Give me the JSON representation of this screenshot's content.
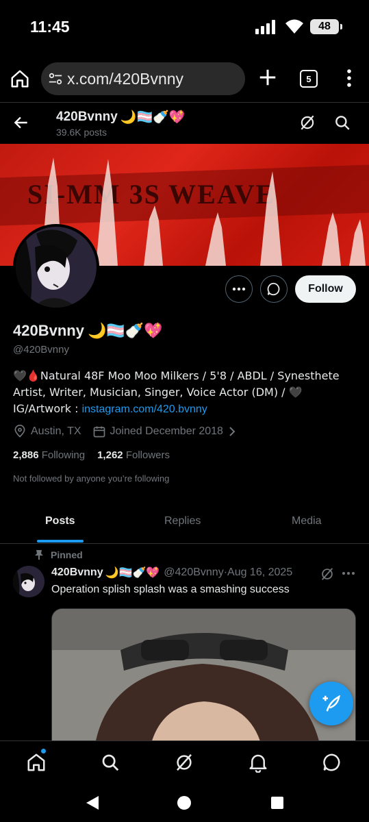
{
  "status_bar": {
    "time": "11:45",
    "battery": "48"
  },
  "browser": {
    "url": "x.com/420Bvnny",
    "tab_count": "5"
  },
  "header": {
    "name": "420Bvnny",
    "name_emojis": "🌙🏳️‍⚧️🍼💖",
    "posts_count": "39.6K posts"
  },
  "banner": {
    "text": "SI-MM 3S WEAVE"
  },
  "actions": {
    "follow_label": "Follow"
  },
  "profile": {
    "display_name": "420Bvnny",
    "name_emojis": "🌙🏳️‍⚧️🍼💖",
    "handle": "@420Bvnny",
    "bio_text": "🖤🩸Natural 48F Moo Moo Milkers / 5'8 / ABDL / Synesthete Artist, Writer, Musician, Singer, Voice Actor (DM) / 🖤 IG/Artwork : ",
    "bio_link": "instagram.com/420.bvnny",
    "location": "Austin, TX",
    "joined": "Joined December 2018",
    "following_count": "2,886",
    "following_label": "Following",
    "followers_count": "1,262",
    "followers_label": "Followers",
    "not_followed": "Not followed by anyone you’re following"
  },
  "tabs": [
    {
      "label": "Posts",
      "active": true
    },
    {
      "label": "Replies",
      "active": false
    },
    {
      "label": "Media",
      "active": false
    }
  ],
  "post": {
    "pinned_label": "Pinned",
    "author_name": "420Bvnny",
    "author_emojis": "🌙🏳️‍⚧️🍼💖",
    "author_handle": "@420Bvnny",
    "separator": " · ",
    "date": "Aug 16, 2025",
    "text": "Operation splish splash was a smashing success"
  },
  "icons": {
    "home": "home-icon",
    "search": "search-icon",
    "grok": "grok-icon",
    "notifications": "bell-icon",
    "messages": "message-icon",
    "compose": "compose-icon"
  },
  "colors": {
    "accent": "#1d9bf0",
    "background": "#000000",
    "text": "#e7e9ea",
    "muted": "#71767b"
  }
}
